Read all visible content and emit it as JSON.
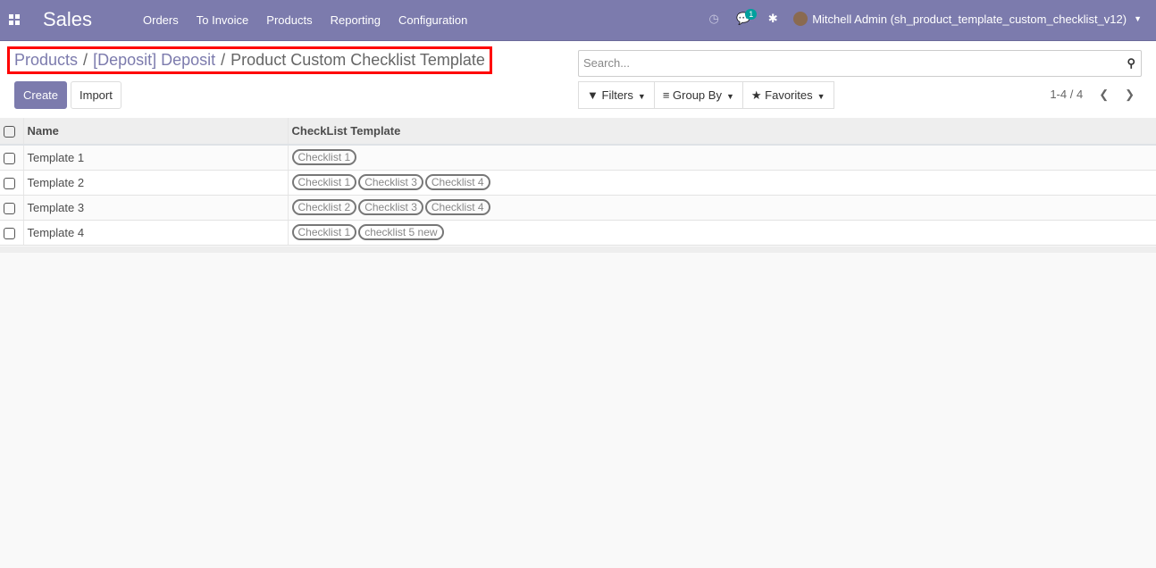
{
  "nav": {
    "app": "Sales",
    "menu": [
      "Orders",
      "To Invoice",
      "Products",
      "Reporting",
      "Configuration"
    ],
    "messages_count": "1",
    "user": "Mitchell Admin (sh_product_template_custom_checklist_v12)"
  },
  "breadcrumb": {
    "items": [
      "Products",
      "[Deposit] Deposit"
    ],
    "current": "Product Custom Checklist Template",
    "separator": "/"
  },
  "buttons": {
    "create": "Create",
    "import": "Import"
  },
  "search": {
    "placeholder": "Search..."
  },
  "filters": {
    "filters": "Filters",
    "group_by": "Group By",
    "favorites": "Favorites"
  },
  "pager": {
    "value": "1-4 / 4"
  },
  "table": {
    "headers": [
      "Name",
      "CheckList Template"
    ],
    "rows": [
      {
        "name": "Template 1",
        "tags": [
          "Checklist 1"
        ]
      },
      {
        "name": "Template 2",
        "tags": [
          "Checklist 1",
          "Checklist 3",
          "Checklist 4"
        ]
      },
      {
        "name": "Template 3",
        "tags": [
          "Checklist 2",
          "Checklist 3",
          "Checklist 4"
        ]
      },
      {
        "name": "Template 4",
        "tags": [
          "Checklist 1",
          "checklist 5 new"
        ]
      }
    ]
  }
}
